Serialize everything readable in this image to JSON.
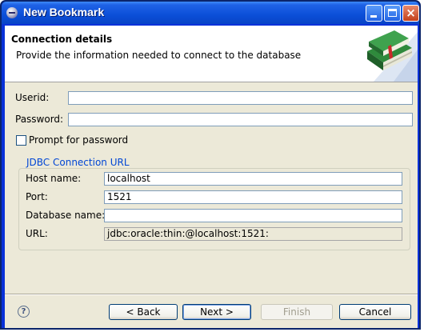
{
  "window": {
    "title": "New Bookmark"
  },
  "header": {
    "title": "Connection details",
    "description": "Provide the information needed to connect to the database"
  },
  "form": {
    "userid": {
      "label": "Userid:",
      "value": ""
    },
    "password": {
      "label": "Password:",
      "value": ""
    },
    "prompt_checkbox": {
      "label": "Prompt for password",
      "checked": false
    }
  },
  "jdbc": {
    "group_title": "JDBC Connection URL",
    "host": {
      "label": "Host name:",
      "value": "localhost"
    },
    "port": {
      "label": "Port:",
      "value": "1521"
    },
    "database": {
      "label": "Database name:",
      "value": ""
    },
    "url": {
      "label": "URL:",
      "value": "jdbc:oracle:thin:@localhost:1521:"
    }
  },
  "buttons": {
    "help": "?",
    "back": "< Back",
    "next": "Next >",
    "finish": "Finish",
    "cancel": "Cancel"
  },
  "colors": {
    "titlebar": "#0b4fd8",
    "group_title": "#0046d5",
    "dialog_bg": "#ece9d8"
  },
  "icons": {
    "title": "eclipse-icon",
    "banner": "book-icon"
  }
}
